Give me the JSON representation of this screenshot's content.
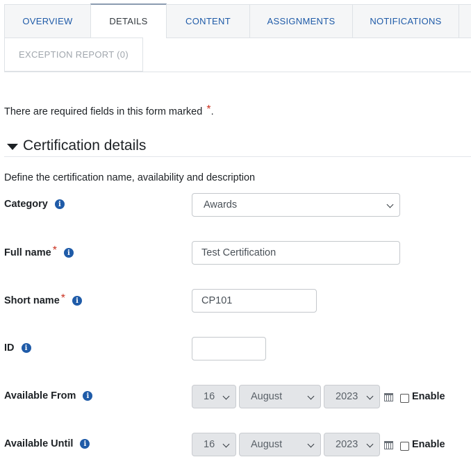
{
  "tabs": [
    {
      "label": "OVERVIEW",
      "state": "normal"
    },
    {
      "label": "DETAILS",
      "state": "active"
    },
    {
      "label": "CONTENT",
      "state": "normal"
    },
    {
      "label": "ASSIGNMENTS",
      "state": "normal"
    },
    {
      "label": "NOTIFICATIONS",
      "state": "normal"
    },
    {
      "label": "EXCEPTION REPORT (0)",
      "state": "disabled"
    }
  ],
  "form": {
    "required_note": "There are required fields in this form marked",
    "required_symbol": "*",
    "required_note_end": ".",
    "section_title": "Certification details",
    "section_desc": "Define the certification name, availability and description",
    "category": {
      "label": "Category",
      "value": "Awards"
    },
    "full_name": {
      "label": "Full name",
      "value": "Test Certification"
    },
    "short_name": {
      "label": "Short name",
      "value": "CP101"
    },
    "id": {
      "label": "ID",
      "value": ""
    },
    "available_from": {
      "label": "Available From",
      "day": "16",
      "month": "August",
      "year": "2023",
      "enable_label": "Enable",
      "enabled": false
    },
    "available_until": {
      "label": "Available Until",
      "day": "16",
      "month": "August",
      "year": "2023",
      "enable_label": "Enable",
      "enabled": false
    }
  },
  "icons": {
    "info": "i"
  },
  "colors": {
    "link": "#1f5ba8",
    "required": "#ca3120"
  }
}
